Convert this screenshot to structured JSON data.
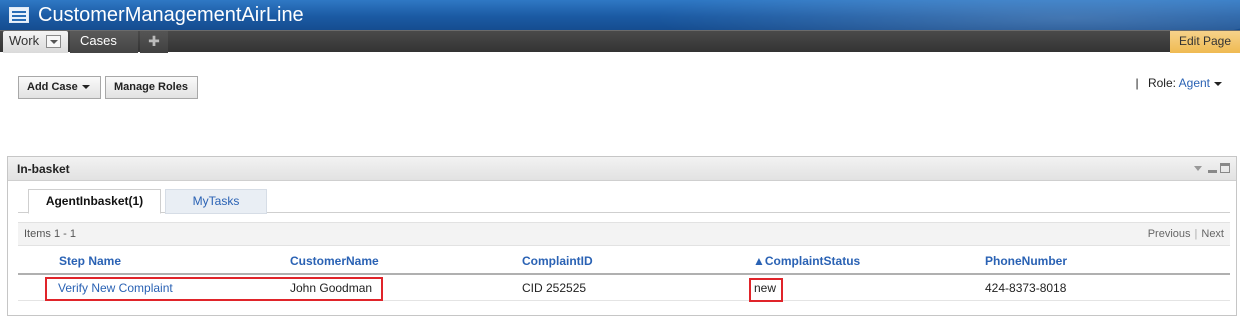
{
  "app": {
    "title": "CustomerManagementAirLine"
  },
  "tabs": {
    "work": "Work",
    "cases": "Cases",
    "add": "✚",
    "edit_page": "Edit Page"
  },
  "toolbar": {
    "add_case": "Add Case",
    "manage_roles": "Manage Roles"
  },
  "role": {
    "separator": "|",
    "label": "Role:",
    "value": "Agent"
  },
  "panel": {
    "title": "In-basket",
    "subtabs": [
      "AgentInbasket(1)",
      "MyTasks"
    ],
    "items_label": "Items 1 - 1",
    "pager": {
      "previous": "Previous",
      "separator": "|",
      "next": "Next"
    },
    "columns": [
      "Step Name",
      "CustomerName",
      "ComplaintID",
      "▲ComplaintStatus",
      "PhoneNumber"
    ],
    "rows": [
      [
        "Verify New Complaint",
        "John Goodman",
        "CID 252525",
        "new",
        "424-8373-8018"
      ]
    ]
  },
  "colors": {
    "title_bar": "#1b5aa3",
    "link": "#2a62b4",
    "edit_page": "#efba52",
    "highlight": "#e0242a"
  }
}
